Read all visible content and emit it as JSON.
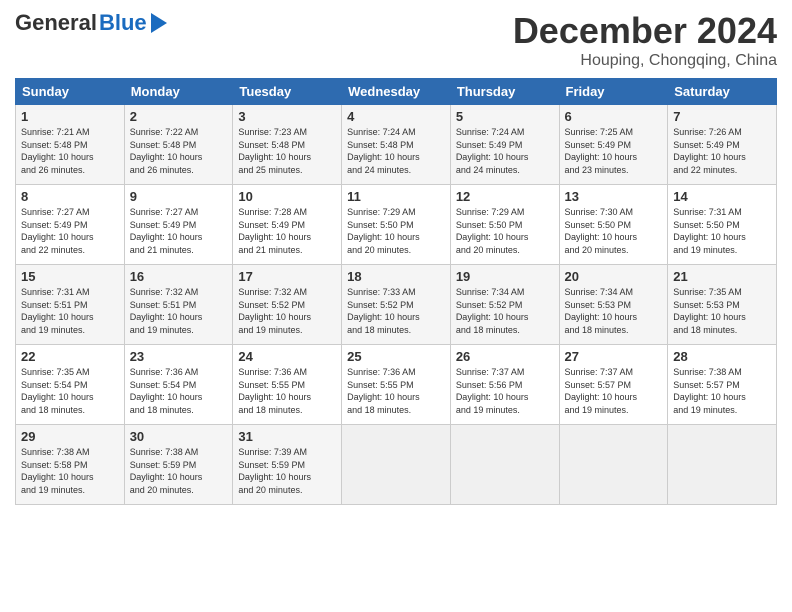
{
  "header": {
    "logo": {
      "general": "General",
      "blue": "Blue"
    },
    "title": "December 2024",
    "subtitle": "Houping, Chongqing, China"
  },
  "calendar": {
    "days_of_week": [
      "Sunday",
      "Monday",
      "Tuesday",
      "Wednesday",
      "Thursday",
      "Friday",
      "Saturday"
    ],
    "weeks": [
      [
        {
          "day": "",
          "info": ""
        },
        {
          "day": "2",
          "info": "Sunrise: 7:22 AM\nSunset: 5:48 PM\nDaylight: 10 hours\nand 26 minutes."
        },
        {
          "day": "3",
          "info": "Sunrise: 7:23 AM\nSunset: 5:48 PM\nDaylight: 10 hours\nand 25 minutes."
        },
        {
          "day": "4",
          "info": "Sunrise: 7:24 AM\nSunset: 5:48 PM\nDaylight: 10 hours\nand 24 minutes."
        },
        {
          "day": "5",
          "info": "Sunrise: 7:24 AM\nSunset: 5:49 PM\nDaylight: 10 hours\nand 24 minutes."
        },
        {
          "day": "6",
          "info": "Sunrise: 7:25 AM\nSunset: 5:49 PM\nDaylight: 10 hours\nand 23 minutes."
        },
        {
          "day": "7",
          "info": "Sunrise: 7:26 AM\nSunset: 5:49 PM\nDaylight: 10 hours\nand 22 minutes."
        }
      ],
      [
        {
          "day": "8",
          "info": "Sunrise: 7:27 AM\nSunset: 5:49 PM\nDaylight: 10 hours\nand 22 minutes."
        },
        {
          "day": "9",
          "info": "Sunrise: 7:27 AM\nSunset: 5:49 PM\nDaylight: 10 hours\nand 21 minutes."
        },
        {
          "day": "10",
          "info": "Sunrise: 7:28 AM\nSunset: 5:49 PM\nDaylight: 10 hours\nand 21 minutes."
        },
        {
          "day": "11",
          "info": "Sunrise: 7:29 AM\nSunset: 5:50 PM\nDaylight: 10 hours\nand 20 minutes."
        },
        {
          "day": "12",
          "info": "Sunrise: 7:29 AM\nSunset: 5:50 PM\nDaylight: 10 hours\nand 20 minutes."
        },
        {
          "day": "13",
          "info": "Sunrise: 7:30 AM\nSunset: 5:50 PM\nDaylight: 10 hours\nand 20 minutes."
        },
        {
          "day": "14",
          "info": "Sunrise: 7:31 AM\nSunset: 5:50 PM\nDaylight: 10 hours\nand 19 minutes."
        }
      ],
      [
        {
          "day": "15",
          "info": "Sunrise: 7:31 AM\nSunset: 5:51 PM\nDaylight: 10 hours\nand 19 minutes."
        },
        {
          "day": "16",
          "info": "Sunrise: 7:32 AM\nSunset: 5:51 PM\nDaylight: 10 hours\nand 19 minutes."
        },
        {
          "day": "17",
          "info": "Sunrise: 7:32 AM\nSunset: 5:52 PM\nDaylight: 10 hours\nand 19 minutes."
        },
        {
          "day": "18",
          "info": "Sunrise: 7:33 AM\nSunset: 5:52 PM\nDaylight: 10 hours\nand 18 minutes."
        },
        {
          "day": "19",
          "info": "Sunrise: 7:34 AM\nSunset: 5:52 PM\nDaylight: 10 hours\nand 18 minutes."
        },
        {
          "day": "20",
          "info": "Sunrise: 7:34 AM\nSunset: 5:53 PM\nDaylight: 10 hours\nand 18 minutes."
        },
        {
          "day": "21",
          "info": "Sunrise: 7:35 AM\nSunset: 5:53 PM\nDaylight: 10 hours\nand 18 minutes."
        }
      ],
      [
        {
          "day": "22",
          "info": "Sunrise: 7:35 AM\nSunset: 5:54 PM\nDaylight: 10 hours\nand 18 minutes."
        },
        {
          "day": "23",
          "info": "Sunrise: 7:36 AM\nSunset: 5:54 PM\nDaylight: 10 hours\nand 18 minutes."
        },
        {
          "day": "24",
          "info": "Sunrise: 7:36 AM\nSunset: 5:55 PM\nDaylight: 10 hours\nand 18 minutes."
        },
        {
          "day": "25",
          "info": "Sunrise: 7:36 AM\nSunset: 5:55 PM\nDaylight: 10 hours\nand 18 minutes."
        },
        {
          "day": "26",
          "info": "Sunrise: 7:37 AM\nSunset: 5:56 PM\nDaylight: 10 hours\nand 19 minutes."
        },
        {
          "day": "27",
          "info": "Sunrise: 7:37 AM\nSunset: 5:57 PM\nDaylight: 10 hours\nand 19 minutes."
        },
        {
          "day": "28",
          "info": "Sunrise: 7:38 AM\nSunset: 5:57 PM\nDaylight: 10 hours\nand 19 minutes."
        }
      ],
      [
        {
          "day": "29",
          "info": "Sunrise: 7:38 AM\nSunset: 5:58 PM\nDaylight: 10 hours\nand 19 minutes."
        },
        {
          "day": "30",
          "info": "Sunrise: 7:38 AM\nSunset: 5:59 PM\nDaylight: 10 hours\nand 20 minutes."
        },
        {
          "day": "31",
          "info": "Sunrise: 7:39 AM\nSunset: 5:59 PM\nDaylight: 10 hours\nand 20 minutes."
        },
        {
          "day": "",
          "info": ""
        },
        {
          "day": "",
          "info": ""
        },
        {
          "day": "",
          "info": ""
        },
        {
          "day": "",
          "info": ""
        }
      ]
    ],
    "first_week_sunday": {
      "day": "1",
      "info": "Sunrise: 7:21 AM\nSunset: 5:48 PM\nDaylight: 10 hours\nand 26 minutes."
    }
  }
}
